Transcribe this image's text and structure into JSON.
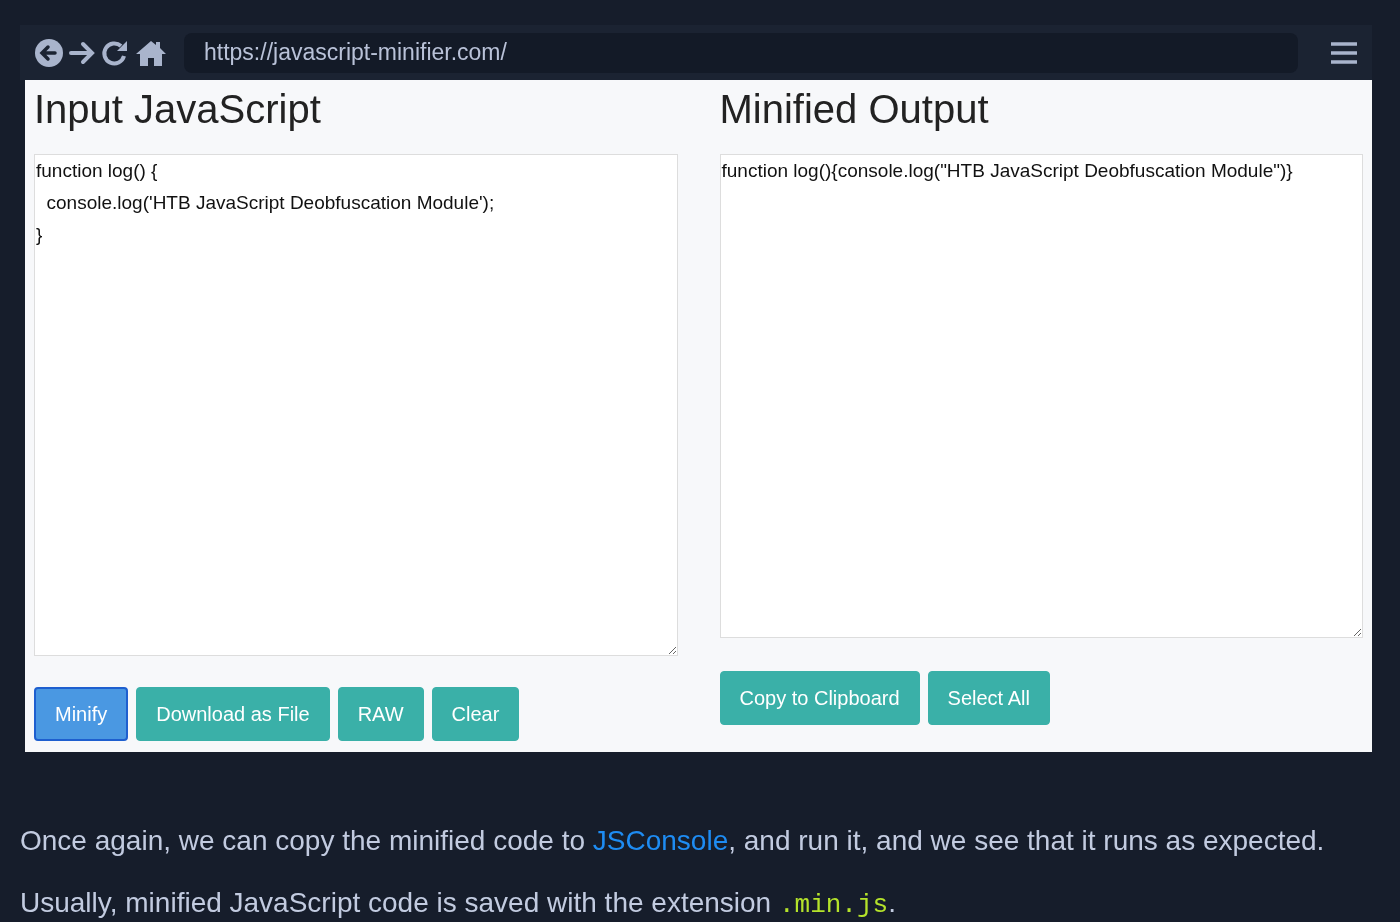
{
  "browser": {
    "url": "https://javascript-minifier.com/"
  },
  "input_panel": {
    "title": "Input JavaScript",
    "code": "function log() {\n  console.log('HTB JavaScript Deobfuscation Module');\n}",
    "buttons": [
      {
        "label": "Minify",
        "focused": true
      },
      {
        "label": "Download as File",
        "focused": false
      },
      {
        "label": "RAW",
        "focused": false
      },
      {
        "label": "Clear",
        "focused": false
      }
    ]
  },
  "output_panel": {
    "title": "Minified Output",
    "code": "function log(){console.log(\"HTB JavaScript Deobfuscation Module\")}",
    "buttons": [
      {
        "label": "Copy to Clipboard",
        "focused": false
      },
      {
        "label": "Select All",
        "focused": false
      }
    ]
  },
  "article": [
    {
      "parts": [
        {
          "kind": "text",
          "text": "Once again, we can copy the minified code to "
        },
        {
          "kind": "link",
          "text": "JSConsole"
        },
        {
          "kind": "text",
          "text": ", and run it, and we see that it runs as expected."
        }
      ]
    },
    {
      "parts": [
        {
          "kind": "text",
          "text": "Usually, minified JavaScript code is saved with the extension "
        },
        {
          "kind": "code",
          "text": ".min.js"
        },
        {
          "kind": "text",
          "text": "."
        }
      ]
    }
  ]
}
